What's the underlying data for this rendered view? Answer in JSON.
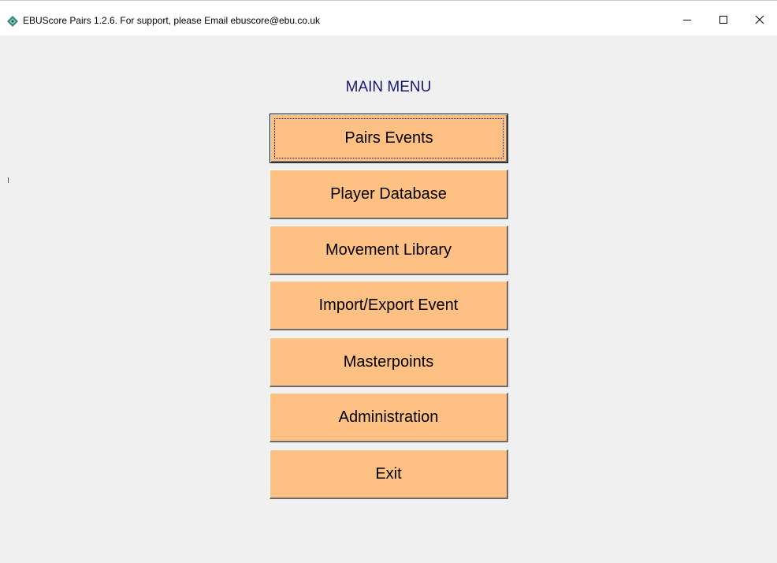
{
  "window": {
    "title": "EBUScore Pairs 1.2.6. For support, please Email ebuscore@ebu.co.uk",
    "app_icon": "diamond-app-icon",
    "controls": {
      "minimize_icon": "minimize-icon",
      "maximize_icon": "maximize-icon",
      "close_icon": "close-icon"
    }
  },
  "main_menu": {
    "title": "MAIN MENU",
    "buttons": [
      {
        "label": "Pairs Events"
      },
      {
        "label": "Player Database"
      },
      {
        "label": "Movement Library"
      },
      {
        "label": "Import/Export Event"
      },
      {
        "label": "Masterpoints"
      },
      {
        "label": "Administration"
      },
      {
        "label": "Exit"
      }
    ]
  },
  "colors": {
    "button_face": "#ffc183",
    "title_text": "#191970",
    "background": "#f0f0f0"
  }
}
